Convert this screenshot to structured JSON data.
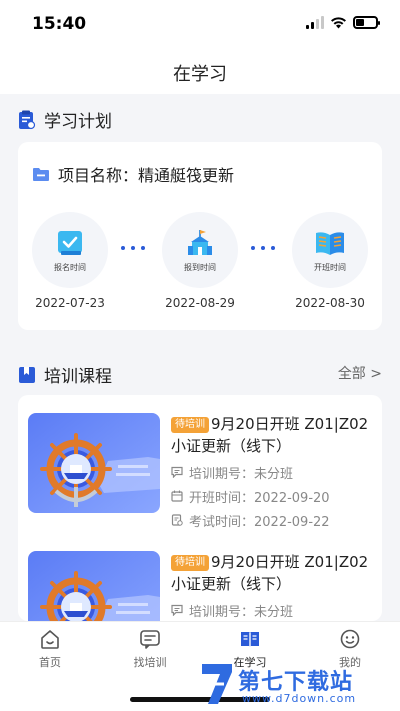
{
  "status": {
    "time": "15:40"
  },
  "header": {
    "title": "在学习"
  },
  "plan": {
    "section_title": "学习计划",
    "project_label": "项目名称：精通艇筏更新",
    "steps": [
      {
        "label": "报名时间",
        "date": "2022-07-23",
        "icon": "document-check-icon"
      },
      {
        "label": "报到时间",
        "date": "2022-08-29",
        "icon": "building-flag-icon"
      },
      {
        "label": "开班时间",
        "date": "2022-08-30",
        "icon": "open-book-icon"
      }
    ]
  },
  "courses": {
    "section_title": "培训课程",
    "more_label": "全部 >",
    "items": [
      {
        "tag": "待培训",
        "title": "9月20日开班 Z01|Z02小证更新（线下）",
        "period": "培训期号：未分班",
        "start": "开班时间：2022-09-20",
        "exam": "考试时间：2022-09-22"
      },
      {
        "tag": "待培训",
        "title": "9月20日开班 Z01|Z02小证更新（线下）",
        "period": "培训期号：未分班"
      }
    ]
  },
  "tabs": [
    {
      "label": "首页",
      "icon": "home-icon"
    },
    {
      "label": "找培训",
      "icon": "message-icon"
    },
    {
      "label": "在学习",
      "icon": "book-icon"
    },
    {
      "label": "我的",
      "icon": "profile-icon"
    }
  ],
  "watermark": {
    "text": "第七下载站",
    "url": "www.d7down.com"
  },
  "colors": {
    "accent": "#2b5bd7",
    "tag": "#f4a237",
    "background": "#f4f5f8"
  }
}
